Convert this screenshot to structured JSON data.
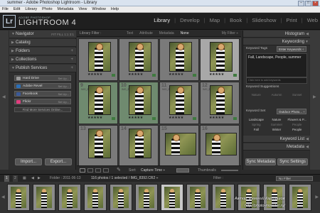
{
  "window": {
    "title": "summer - Adobe Photoshop Lightroom - Library",
    "controls": [
      "–",
      "□",
      "×"
    ]
  },
  "menu": [
    "File",
    "Edit",
    "Library",
    "Photo",
    "Metadata",
    "View",
    "Window",
    "Help"
  ],
  "identity": {
    "logo": "Lr",
    "vendor": "ADOBE PHOTOSHOP",
    "product": "LIGHTROOM 4"
  },
  "modules": {
    "items": [
      "Library",
      "Develop",
      "Map",
      "Book",
      "Slideshow",
      "Print",
      "Web"
    ],
    "active": "Library",
    "separator": "|"
  },
  "left_panel": {
    "navigator": {
      "label": "Navigator",
      "zooms": "FIT  FILL  1:1  3:1"
    },
    "sections": [
      "Catalog",
      "Folders",
      "Collections",
      "Publish Services"
    ],
    "services": [
      {
        "name": "Hard Drive",
        "setting": "Set Up...",
        "color": "#9a9a9a"
      },
      {
        "name": "Adobe Revel",
        "setting": "Set Up...",
        "color": "#2b6fb8"
      },
      {
        "name": "Facebook",
        "setting": "Set Up...",
        "color": "#3b5998"
      },
      {
        "name": "Flickr",
        "setting": "Set Up...",
        "color": "#e23c7e"
      }
    ],
    "find_more": "Find More Services Online...",
    "import_label": "Import...",
    "export_label": "Export..."
  },
  "library_filter": {
    "title": "Library Filter :",
    "options": [
      "Text",
      "Attribute",
      "Metadata",
      "None"
    ],
    "active": "None",
    "preset": "My Filter ÷"
  },
  "grid": {
    "cells": [
      {
        "num": "",
        "meta": "",
        "stars": "★★★★★",
        "orientation": "portrait",
        "state": "normal"
      },
      {
        "num": "",
        "meta": "",
        "stars": "★★★★★",
        "orientation": "portrait",
        "state": "normal"
      },
      {
        "num": "",
        "meta": "",
        "stars": "★★★★★",
        "orientation": "portrait",
        "state": "normal"
      },
      {
        "num": "",
        "meta": "",
        "stars": "★★★★★",
        "orientation": "portrait",
        "state": "selected"
      },
      {
        "num": "9",
        "meta": "IMG_8389",
        "stars": "★★★★★",
        "orientation": "portrait",
        "state": "green"
      },
      {
        "num": "10",
        "meta": "IMG_8390",
        "stars": "★★★★★",
        "orientation": "portrait",
        "state": "green"
      },
      {
        "num": "11",
        "meta": "IMG_8391",
        "stars": "★★★★★",
        "orientation": "portrait",
        "state": "normal"
      },
      {
        "num": "12",
        "meta": "IMG_8392",
        "stars": "★★★★★",
        "orientation": "portrait",
        "state": "normal"
      },
      {
        "num": "13",
        "meta": "",
        "stars": "",
        "orientation": "portrait",
        "state": "normal"
      },
      {
        "num": "14",
        "meta": "",
        "stars": "",
        "orientation": "portrait",
        "state": "normal"
      },
      {
        "num": "15",
        "meta": "",
        "stars": "",
        "orientation": "landscape",
        "state": "normal"
      },
      {
        "num": "16",
        "meta": "",
        "stars": "",
        "orientation": "landscape",
        "state": "normal"
      }
    ]
  },
  "toolbar": {
    "sort_label": "Sort:",
    "sort_value": "Capture Time ÷",
    "thumbnails_label": "Thumbnails"
  },
  "right_panel": {
    "histogram": "Histogram",
    "keywording": "Keywording",
    "keyword_tags_label": "Keyword Tags",
    "keyword_tags_mode": "Enter Keywords ÷",
    "keywords_value": "Fall, Landscape, People, summer",
    "add_keywords_placeholder": "Click here to add keywords",
    "suggestions_title": "Keyword Suggestions",
    "suggestions": [
      "Nature",
      "Autumn",
      "Sunset"
    ],
    "keyword_set_label": "Keyword Set",
    "keyword_set_value": "Outdoor Photo... ÷",
    "keyword_set": [
      "Landscape",
      "Nature",
      "Flowers & P...",
      "Spring",
      "Summer",
      "People",
      "Fall",
      "Winter",
      "People"
    ],
    "keyword_list": "Keyword List",
    "metadata": "Metadata",
    "sync_metadata": "Sync Metadata",
    "sync_settings": "Sync Settings"
  },
  "filmstrip": {
    "pages": [
      "1",
      "2"
    ],
    "folder_path": "Folder : 2011-06-13",
    "selection": "116 photos / 1 selected / IMG_8392.CR2 ÷",
    "filter_label": "Filter :",
    "filter_value": "No Filter"
  },
  "watermark": {
    "line1": "Автор: Евгений Карташов",
    "line2": "http://photo-monster.ru/"
  }
}
